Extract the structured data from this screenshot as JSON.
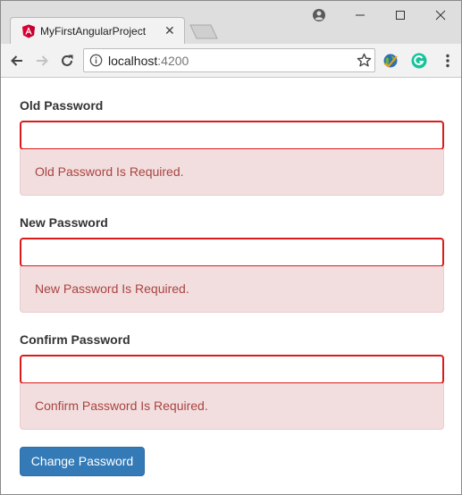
{
  "browser": {
    "tab_title": "MyFirstAngularProject",
    "url_host": "localhost",
    "url_port": ":4200",
    "accent_angular": "#dd0031",
    "accent_grammarly": "#15c39a"
  },
  "form": {
    "old_password": {
      "label": "Old Password",
      "value": "",
      "error": "Old Password Is Required."
    },
    "new_password": {
      "label": "New Password",
      "value": "",
      "error": "New Password Is Required."
    },
    "confirm_password": {
      "label": "Confirm Password",
      "value": "",
      "error": "Confirm Password Is Required."
    },
    "submit_label": "Change Password",
    "colors": {
      "error_border": "#dc1a1a",
      "alert_bg": "#f2dede",
      "alert_text": "#a94442",
      "button_bg": "#337ab7"
    }
  }
}
